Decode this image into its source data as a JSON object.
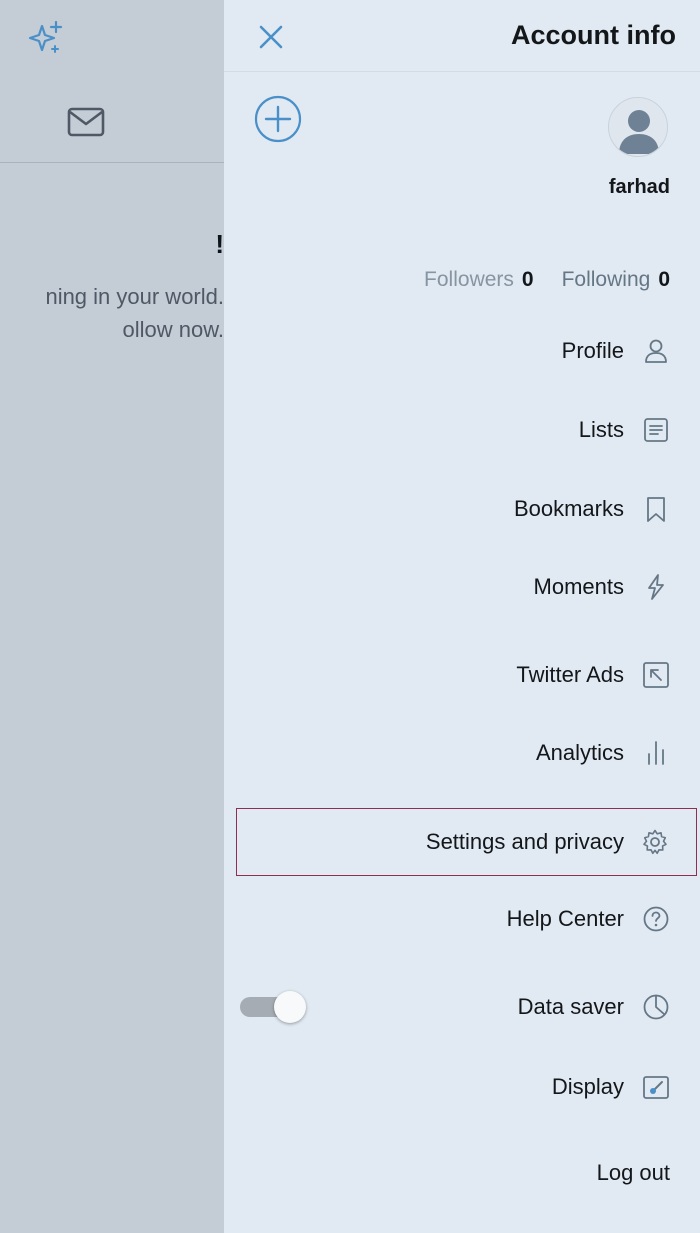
{
  "colors": {
    "accent": "#4a90c8",
    "drawer_bg": "#e1e9f2",
    "dim_bg": "#c4ccd6",
    "highlight_border": "#8e2f4f",
    "text_primary": "#14171a",
    "text_secondary": "#657786"
  },
  "background": {
    "heading": "!",
    "line1": "ning in your world.",
    "line2": "ollow now.",
    "icons": [
      "sparkle-icon",
      "mail-icon"
    ]
  },
  "drawer": {
    "title": "Account info",
    "close_icon": "close-icon",
    "add_account_icon": "plus-circle-icon",
    "username": "farhad",
    "following_count": "0",
    "following_label": "Following",
    "followers_count": "0",
    "followers_label": "Followers"
  },
  "menu": {
    "profile": "Profile",
    "lists": "Lists",
    "bookmarks": "Bookmarks",
    "moments": "Moments",
    "twitter_ads": "Twitter Ads",
    "analytics": "Analytics",
    "settings": "Settings and privacy",
    "help": "Help Center",
    "data_saver": "Data saver",
    "display": "Display",
    "logout": "Log out"
  },
  "data_saver_enabled": false
}
